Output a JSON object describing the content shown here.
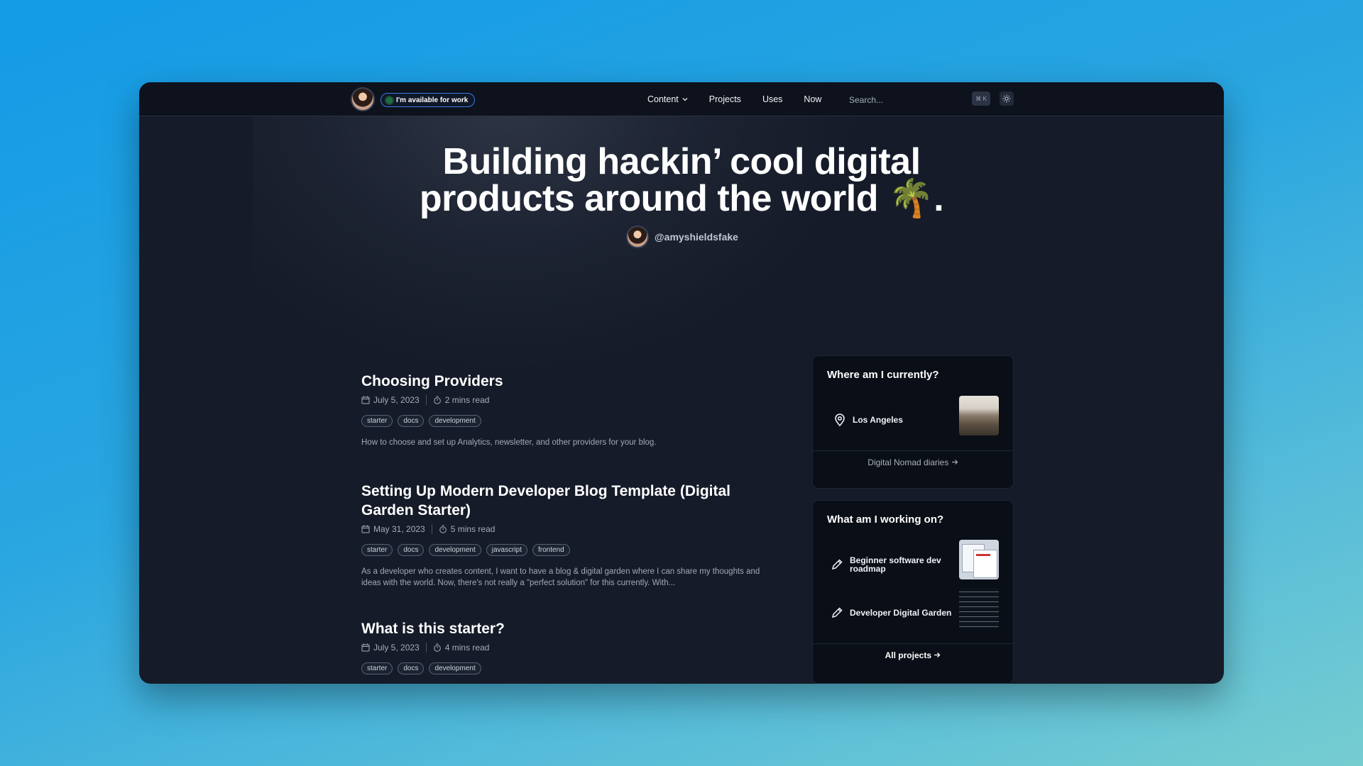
{
  "header": {
    "availability": "I'm available for work",
    "nav": [
      {
        "label": "Content"
      },
      {
        "label": "Projects"
      },
      {
        "label": "Uses"
      },
      {
        "label": "Now"
      }
    ],
    "search_placeholder": "Search...",
    "shortcut": "⌘ K"
  },
  "hero": {
    "title_line1": "Building hackin’ cool digital",
    "title_line2": "products around the world 🌴.",
    "handle": "@amyshieldsfake"
  },
  "posts": [
    {
      "title": "Choosing Providers",
      "date": "July 5, 2023",
      "read": "2 mins read",
      "tags": [
        "starter",
        "docs",
        "development"
      ],
      "excerpt": "How to choose and set up Analytics, newsletter, and other providers for your blog."
    },
    {
      "title": "Setting Up Modern Developer Blog Template (Digital Garden Starter)",
      "date": "May 31, 2023",
      "read": "5 mins read",
      "tags": [
        "starter",
        "docs",
        "development",
        "javascript",
        "frontend"
      ],
      "excerpt": "As a developer who creates content, I want to have a blog & digital garden where I can share my thoughts and ideas with the world. Now, there's not really a \"perfect solution\" for this currently. With..."
    },
    {
      "title": "What is this starter?",
      "date": "July 5, 2023",
      "read": "4 mins read",
      "tags": [
        "starter",
        "docs",
        "development"
      ],
      "excerpt": ""
    }
  ],
  "location_card": {
    "title": "Where am I currently?",
    "location": "Los Angeles",
    "link": "Digital Nomad diaries"
  },
  "work_card": {
    "title": "What am I working on?",
    "items": [
      {
        "label": "Beginner software dev roadmap"
      },
      {
        "label": "Developer Digital Garden"
      }
    ],
    "link": "All projects"
  },
  "colors": {
    "accent_border": "#3a7be0",
    "status_dot": "#1f6d43",
    "window_bg": "#151b28"
  }
}
